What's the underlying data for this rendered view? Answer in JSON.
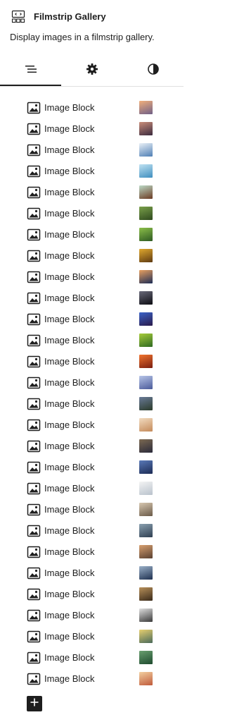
{
  "header": {
    "title": "Filmstrip Gallery",
    "description": "Display images in a filmstrip gallery.",
    "block_icon": "filmstrip-gallery-icon"
  },
  "tabs": [
    {
      "icon": "list-view-icon",
      "active": true
    },
    {
      "icon": "settings-gear-icon",
      "active": false
    },
    {
      "icon": "styles-contrast-icon",
      "active": false
    }
  ],
  "items": [
    {
      "label": "Image Block",
      "thumb": [
        "#f1b07c",
        "#6f5f86"
      ]
    },
    {
      "label": "Image Block",
      "thumb": [
        "#c98d7a",
        "#3b2a3e"
      ]
    },
    {
      "label": "Image Block",
      "thumb": [
        "#e9f0f7",
        "#4f7fb5"
      ]
    },
    {
      "label": "Image Block",
      "thumb": [
        "#bfe2f2",
        "#3f8fbf"
      ]
    },
    {
      "label": "Image Block",
      "thumb": [
        "#bcd9c6",
        "#6b3a22"
      ]
    },
    {
      "label": "Image Block",
      "thumb": [
        "#7aa04a",
        "#2f4a1e"
      ]
    },
    {
      "label": "Image Block",
      "thumb": [
        "#8cbf4a",
        "#2e5a22"
      ]
    },
    {
      "label": "Image Block",
      "thumb": [
        "#e0a82e",
        "#5e3a12"
      ]
    },
    {
      "label": "Image Block",
      "thumb": [
        "#e9a060",
        "#1d2c55"
      ]
    },
    {
      "label": "Image Block",
      "thumb": [
        "#6a6a7a",
        "#0c0c12"
      ]
    },
    {
      "label": "Image Block",
      "thumb": [
        "#3b63c8",
        "#2a1a4a"
      ]
    },
    {
      "label": "Image Block",
      "thumb": [
        "#a7cc3a",
        "#2e6a22"
      ]
    },
    {
      "label": "Image Block",
      "thumb": [
        "#f1742e",
        "#7a1e10"
      ]
    },
    {
      "label": "Image Block",
      "thumb": [
        "#b7c5e8",
        "#4a5a9a"
      ]
    },
    {
      "label": "Image Block",
      "thumb": [
        "#6a7b98",
        "#2b3b2a"
      ]
    },
    {
      "label": "Image Block",
      "thumb": [
        "#f2dcc0",
        "#c48a5a"
      ]
    },
    {
      "label": "Image Block",
      "thumb": [
        "#7d6a52",
        "#2a2a3a"
      ]
    },
    {
      "label": "Image Block",
      "thumb": [
        "#5a7ab8",
        "#1c2b55"
      ]
    },
    {
      "label": "Image Block",
      "thumb": [
        "#f4f4f4",
        "#b9c2cc"
      ]
    },
    {
      "label": "Image Block",
      "thumb": [
        "#d7c7b0",
        "#6a5a48"
      ]
    },
    {
      "label": "Image Block",
      "thumb": [
        "#8aa0b0",
        "#2f3f52"
      ]
    },
    {
      "label": "Image Block",
      "thumb": [
        "#d7a070",
        "#5a4030"
      ]
    },
    {
      "label": "Image Block",
      "thumb": [
        "#9ab0c8",
        "#1e3050"
      ]
    },
    {
      "label": "Image Block",
      "thumb": [
        "#b7905a",
        "#3a2a1a"
      ]
    },
    {
      "label": "Image Block",
      "thumb": [
        "#e0e0e0",
        "#3a3a3a"
      ]
    },
    {
      "label": "Image Block",
      "thumb": [
        "#e8d070",
        "#4a6a5a"
      ]
    },
    {
      "label": "Image Block",
      "thumb": [
        "#6aa070",
        "#1e4a2e"
      ]
    },
    {
      "label": "Image Block",
      "thumb": [
        "#f2cfa0",
        "#c05a3a"
      ]
    }
  ],
  "add_button": {
    "icon": "plus-icon"
  }
}
